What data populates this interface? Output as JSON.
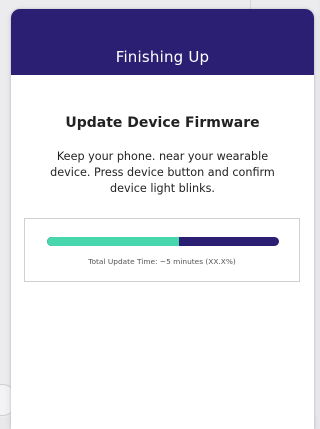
{
  "modal": {
    "title": "Finishing Up"
  },
  "content": {
    "heading": "Update Device Firmware",
    "instructions": "Keep your phone. near your wearable device.  Press device button and confirm device light blinks."
  },
  "progress": {
    "fraction": 0.57,
    "caption": "Total Update Time: ~5 minutes (XX.X%)"
  },
  "colors": {
    "header_bg": "#2a1f73",
    "progress_fill": "#48d6ad",
    "progress_track": "#2a1f73"
  }
}
